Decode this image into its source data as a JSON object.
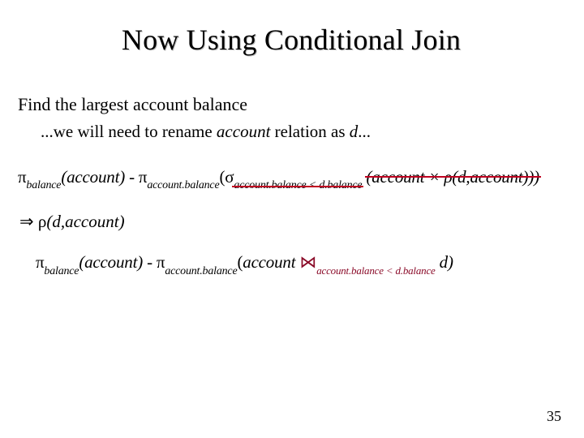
{
  "title": "Now Using Conditional Join",
  "lead": "Find the largest account balance",
  "sub_prefix": "...we will need to rename ",
  "sub_ital": "account",
  "sub_mid": " relation as ",
  "sub_ital2": "d",
  "sub_suffix": "...",
  "sym": {
    "pi": "π",
    "sigma": "σ",
    "rho": "ρ",
    "times": "×",
    "minus": "-",
    "lt": "<",
    "implies": "⇒",
    "join": "⋈"
  },
  "sub1": "balance",
  "sub2": "account.balance",
  "cond_lhs": "account.balance",
  "cond_rhs": "d.balance",
  "rel_account": "account",
  "rel_d": "d",
  "f1": {
    "strike_inner": "(account × ρ(d,account)))"
  },
  "f2": {
    "rho_args": "(d,account)"
  },
  "f3": {
    "tail": " d)"
  },
  "page": "35"
}
